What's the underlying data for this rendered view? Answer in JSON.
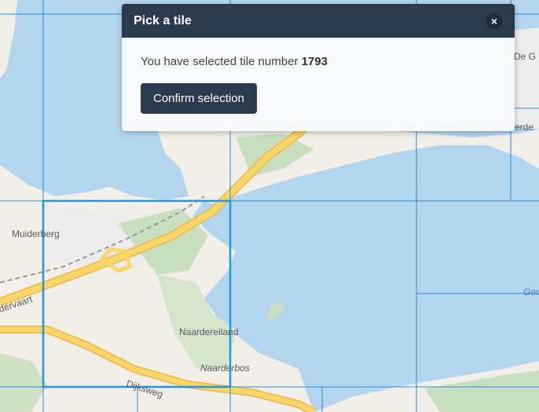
{
  "map": {
    "labels": {
      "muiderberg": "Muiderberg",
      "naardereiland": "Naardereiland",
      "naarderbos": "Naarderbos",
      "hollandse_tunnel": "Dijksweg",
      "vaart": "dervaart",
      "de_g": "De G",
      "erde": "erde",
      "gooi": "Goo"
    },
    "selected_tile": 1793
  },
  "popup": {
    "title": "Pick a tile",
    "close_symbol": "×",
    "message_prefix": "You have selected tile number ",
    "tile_number": "1793",
    "confirm_label": "Confirm selection"
  },
  "colors": {
    "water": "#b3d6ee",
    "land": "#f2efe9",
    "green": "#c8dfc0",
    "road": "#f8d667",
    "grid": "#2b8fd6",
    "header": "#2c3a4d"
  }
}
